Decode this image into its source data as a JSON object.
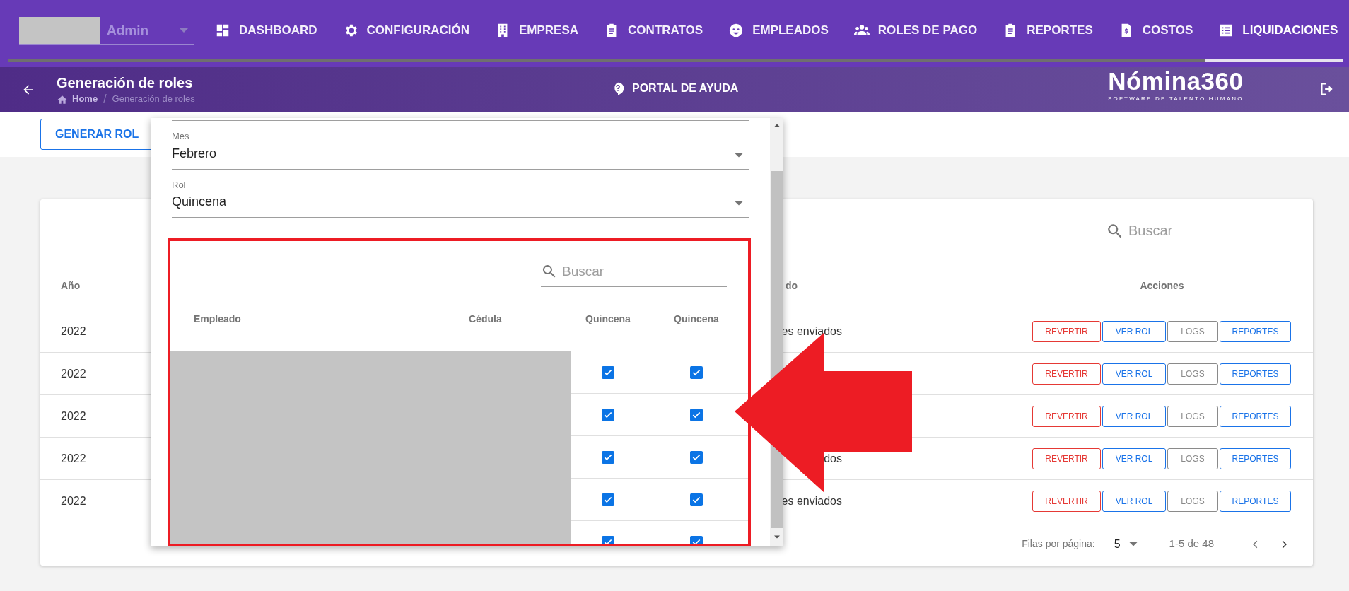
{
  "nav": {
    "user_field": {
      "value": "Admin"
    },
    "tabs": [
      {
        "label": "DASHBOARD",
        "selected": false
      },
      {
        "label": "CONFIGURACIÓN",
        "selected": false
      },
      {
        "label": "EMPRESA",
        "selected": false
      },
      {
        "label": "CONTRATOS",
        "selected": false
      },
      {
        "label": "EMPLEADOS",
        "selected": false
      },
      {
        "label": "ROLES DE PAGO",
        "selected": false
      },
      {
        "label": "REPORTES",
        "selected": false
      },
      {
        "label": "COSTOS",
        "selected": false
      },
      {
        "label": "LIQUIDACIONES",
        "selected": true
      }
    ]
  },
  "page_header": {
    "title": "Generación de roles",
    "breadcrumb": [
      "Home",
      "Generación de roles"
    ],
    "breadcrumb_separator": "/",
    "help_link": "PORTAL DE AYUDA",
    "logo": {
      "name": "Nómina360",
      "tagline": "SOFTWARE DE TALENTO HUMANO"
    }
  },
  "toolbar": {
    "button": "GENERAR ROL"
  },
  "roles_table": {
    "search_placeholder": "Buscar",
    "columns": [
      "Año",
      "do",
      "Acciones"
    ],
    "rows": [
      {
        "year": "2022",
        "status": "es enviados",
        "actions": [
          {
            "label": "REVERTIR",
            "kind": "danger"
          },
          {
            "label": "VER ROL",
            "kind": "primary"
          },
          {
            "label": "LOGS",
            "kind": "neutral"
          },
          {
            "label": "REPORTES",
            "kind": "primary"
          }
        ]
      },
      {
        "year": "2022",
        "actions": [
          {
            "label": "REVERTIR",
            "kind": "danger"
          },
          {
            "label": "VER ROL",
            "kind": "primary"
          },
          {
            "label": "LOGS",
            "kind": "neutral"
          },
          {
            "label": "REPORTES",
            "kind": "primary"
          }
        ]
      },
      {
        "year": "2022",
        "actions": [
          {
            "label": "REVERTIR",
            "kind": "danger"
          },
          {
            "label": "VER ROL",
            "kind": "primary"
          },
          {
            "label": "LOGS",
            "kind": "neutral"
          },
          {
            "label": "REPORTES",
            "kind": "primary"
          }
        ]
      },
      {
        "year": "2022",
        "status": "dos",
        "actions": [
          {
            "label": "REVERTIR",
            "kind": "danger"
          },
          {
            "label": "VER ROL",
            "kind": "primary"
          },
          {
            "label": "LOGS",
            "kind": "neutral"
          },
          {
            "label": "REPORTES",
            "kind": "primary"
          }
        ]
      },
      {
        "year": "2022",
        "status": "es enviados",
        "actions": [
          {
            "label": "REVERTIR",
            "kind": "danger"
          },
          {
            "label": "VER ROL",
            "kind": "primary"
          },
          {
            "label": "LOGS",
            "kind": "neutral"
          },
          {
            "label": "REPORTES",
            "kind": "primary"
          }
        ]
      }
    ],
    "footer": {
      "rows_per_page_label": "Filas por página:",
      "rows_per_page": "5",
      "range": "1-5 de 48"
    }
  },
  "dialog": {
    "fields": [
      {
        "label": "Mes",
        "value": "Febrero"
      },
      {
        "label": "Rol",
        "value": "Quincena"
      }
    ],
    "employee_table": {
      "search_placeholder": "Buscar",
      "columns": [
        "Empleado",
        "Cédula",
        "Quincena",
        "Quincena"
      ],
      "rows": [
        {
          "checks": [
            true,
            true
          ]
        },
        {
          "checks": [
            true,
            true
          ]
        },
        {
          "checks": [
            true,
            true
          ]
        },
        {
          "checks": [
            true,
            true
          ]
        },
        {
          "checks": [
            true,
            true
          ]
        }
      ]
    }
  }
}
